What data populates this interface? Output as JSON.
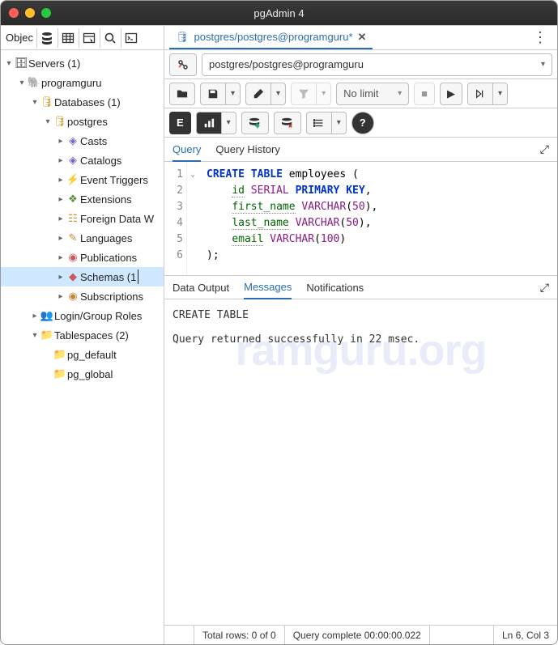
{
  "window": {
    "title": "pgAdmin 4"
  },
  "side_toolbar_label": "Objec",
  "tree": {
    "servers": "Servers (1)",
    "server_name": "programguru",
    "databases": "Databases (1)",
    "db": "postgres",
    "items": {
      "casts": "Casts",
      "catalogs": "Catalogs",
      "event_triggers": "Event Triggers",
      "extensions": "Extensions",
      "fdw": "Foreign Data W",
      "languages": "Languages",
      "publications": "Publications",
      "schemas": "Schemas (1",
      "subscriptions": "Subscriptions"
    },
    "login_roles": "Login/Group Roles",
    "tablespaces": "Tablespaces (2)",
    "ts_default": "pg_default",
    "ts_global": "pg_global"
  },
  "tab": {
    "label": "postgres/postgres@programguru*",
    "conn": "postgres/postgres@programguru"
  },
  "toolbar": {
    "nolimit": "No limit"
  },
  "inner_tabs": {
    "query": "Query",
    "history": "Query History"
  },
  "sql": {
    "l1a": "CREATE",
    "l1b": "TABLE",
    "l1c": "employees",
    "l1d": "(",
    "l2a": "id",
    "l2b": "SERIAL",
    "l2c": "PRIMARY",
    "l2d": "KEY",
    "l2e": ",",
    "l3a": "first_name",
    "l3b": "VARCHAR",
    "l3c": "(",
    "l3d": "50",
    "l3e": ")",
    "l3f": ",",
    "l4a": "last_name",
    "l4b": "VARCHAR",
    "l4c": "(",
    "l4d": "50",
    "l4e": ")",
    "l4f": ",",
    "l5a": "email",
    "l5b": "VARCHAR",
    "l5c": "(",
    "l5d": "100",
    "l5e": ")",
    "l6a": ");"
  },
  "out_tabs": {
    "data": "Data Output",
    "msg": "Messages",
    "notif": "Notifications"
  },
  "messages": {
    "l1": "CREATE TABLE",
    "l2": "Query returned successfully in 22 msec."
  },
  "status": {
    "rows": "Total rows: 0 of 0",
    "complete": "Query complete 00:00:00.022",
    "pos": "Ln 6, Col 3"
  },
  "watermark": "ramguru.org"
}
